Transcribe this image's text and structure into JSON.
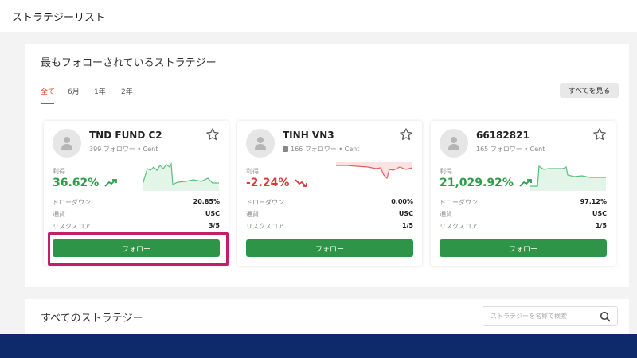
{
  "header": {
    "title": "ストラテジーリスト"
  },
  "featured": {
    "title": "最もフォローされているストラテジー",
    "tabs": [
      {
        "label": "全て",
        "active": true
      },
      {
        "label": "6月",
        "active": false
      },
      {
        "label": "1年",
        "active": false
      },
      {
        "label": "2年",
        "active": false
      }
    ],
    "see_all_label": "すべてを見る"
  },
  "cards": [
    {
      "name": "TND FUND C2",
      "subtitle": "399 フォロワー • Cent",
      "locked": false,
      "profit_label": "利得",
      "profit": "36.62%",
      "profit_direction": "up",
      "rows": [
        {
          "label": "ドローダウン",
          "value": "20.85%"
        },
        {
          "label": "通貨",
          "value": "USC"
        },
        {
          "label": "リスクスコア",
          "value": "3/5"
        }
      ],
      "follow_label": "フォロー",
      "highlighted": true
    },
    {
      "name": "TINH VN3",
      "subtitle": "166 フォロワー • Cent",
      "locked": true,
      "profit_label": "利得",
      "profit": "-2.24%",
      "profit_direction": "down",
      "rows": [
        {
          "label": "ドローダウン",
          "value": "0.00%"
        },
        {
          "label": "通貨",
          "value": "USC"
        },
        {
          "label": "リスクスコア",
          "value": "1/5"
        }
      ],
      "follow_label": "フォロー",
      "highlighted": false
    },
    {
      "name": "66182821",
      "subtitle": "165 フォロワー • Cent",
      "locked": false,
      "profit_label": "利得",
      "profit": "21,029.92%",
      "profit_direction": "up",
      "rows": [
        {
          "label": "ドローダウン",
          "value": "97.12%"
        },
        {
          "label": "通貨",
          "value": "USC"
        },
        {
          "label": "リスクスコア",
          "value": "1/5"
        }
      ],
      "follow_label": "フォロー",
      "highlighted": false
    }
  ],
  "all_strategies": {
    "title": "すべてのストラテジー",
    "search_placeholder": "ストラテジーを名称で検索"
  },
  "colors": {
    "accent": "#d4472b",
    "positive": "#2e9c48",
    "negative": "#d93a3a",
    "button_green": "#2e9548",
    "highlight": "#c41e6b",
    "footer": "#0f2a6a"
  }
}
